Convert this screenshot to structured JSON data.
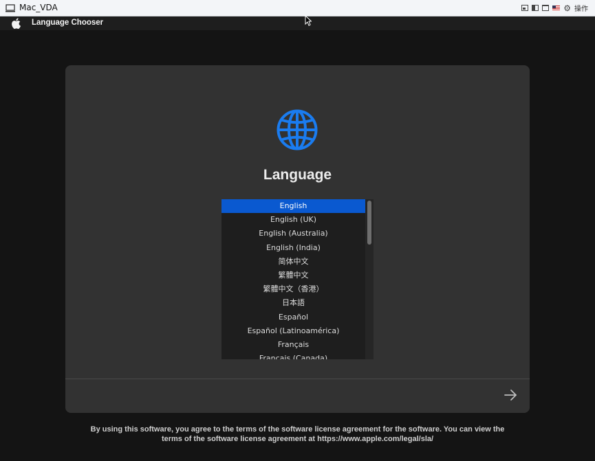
{
  "vm_window": {
    "title": "Mac_VDA",
    "icons": [
      "monitor-icon",
      "window-mode-1-icon",
      "window-mode-2-icon",
      "window-mode-3-icon",
      "us-flag-icon",
      "gear-icon"
    ],
    "operations_label": "操作"
  },
  "menubar": {
    "app_name": "Language Chooser",
    "icon": "apple-logo-icon"
  },
  "dialog": {
    "icon": "globe-icon",
    "title": "Language",
    "languages": [
      "English",
      "English (UK)",
      "English (Australia)",
      "English (India)",
      "简体中文",
      "繁體中文",
      "繁體中文（香港）",
      "日本語",
      "Español",
      "Español (Latinoamérica)",
      "Français",
      "Français (Canada)"
    ],
    "selected_language": "English",
    "next_icon": "arrow-right-icon"
  },
  "license": {
    "line1": "By using this software, you agree to the terms of the software license agreement for the software. You can view the",
    "line2": "terms of the software license agreement at https://www.apple.com/legal/sla/"
  },
  "colors": {
    "accent": "#0a59d0",
    "globe": "#1a7cf0",
    "background": "#141414",
    "dialog": "#323232"
  }
}
